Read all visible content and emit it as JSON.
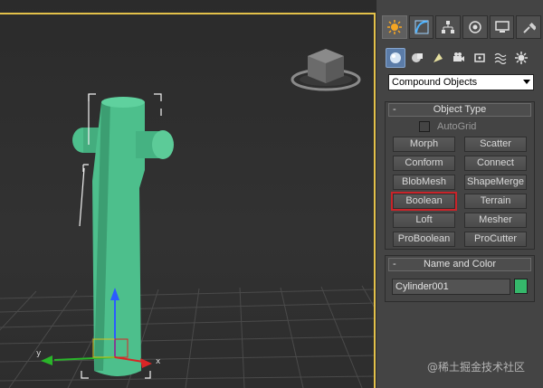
{
  "viewport": {
    "axis_labels": {
      "x": "x",
      "y": "y"
    },
    "object_color": "#4dbf8c",
    "frame_color": "#e3c14a"
  },
  "command_panel": {
    "tabs": [
      {
        "name": "create",
        "icon": "sun-star-icon",
        "active": true
      },
      {
        "name": "modify",
        "icon": "curve-arc-icon",
        "active": false
      },
      {
        "name": "hierarchy",
        "icon": "hierarchy-tree-icon",
        "active": false
      },
      {
        "name": "motion",
        "icon": "motion-target-icon",
        "active": false
      },
      {
        "name": "display",
        "icon": "monitor-icon",
        "active": false
      },
      {
        "name": "utilities",
        "icon": "hammer-icon",
        "active": false
      }
    ],
    "create_categories": [
      {
        "name": "geometry",
        "icon": "sphere-icon",
        "active": true
      },
      {
        "name": "shapes",
        "icon": "shapes-icon",
        "active": false
      },
      {
        "name": "lights",
        "icon": "light-icon",
        "active": false
      },
      {
        "name": "cameras",
        "icon": "camera-icon",
        "active": false
      },
      {
        "name": "helpers",
        "icon": "tape-helper-icon",
        "active": false
      },
      {
        "name": "space-warps",
        "icon": "wave-icon",
        "active": false
      },
      {
        "name": "systems",
        "icon": "gear-icon",
        "active": false
      }
    ],
    "category_dropdown": {
      "value": "Compound Objects"
    },
    "object_type": {
      "header": "Object Type",
      "collapse_symbol": "-",
      "autogrid_label": "AutoGrid",
      "autogrid_checked": false,
      "buttons": [
        "Morph",
        "Scatter",
        "Conform",
        "Connect",
        "BlobMesh",
        "ShapeMerge",
        "Boolean",
        "Terrain",
        "Loft",
        "Mesher",
        "ProBoolean",
        "ProCutter"
      ],
      "highlighted_button": "Boolean"
    },
    "name_and_color": {
      "header": "Name and Color",
      "collapse_symbol": "-",
      "name_value": "Cylinder001",
      "color": "#35b86b"
    }
  },
  "watermark": "@稀土掘金技术社区"
}
